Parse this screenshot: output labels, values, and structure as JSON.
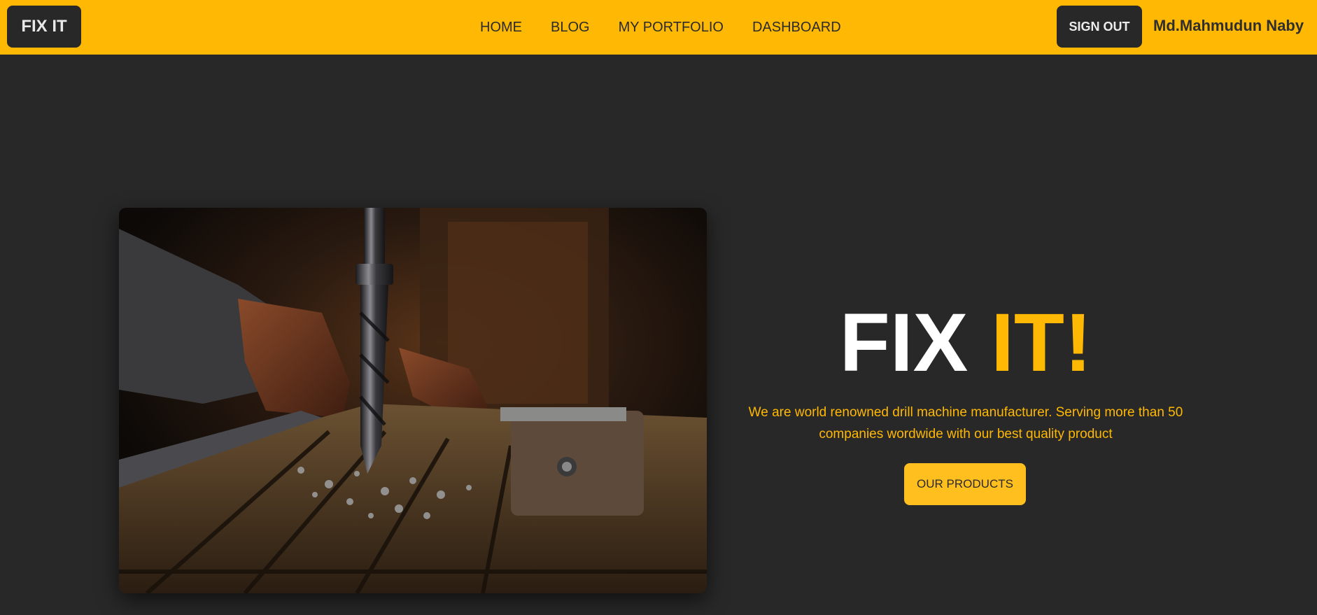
{
  "brand": {
    "label": "FIX IT"
  },
  "nav": {
    "items": [
      {
        "label": "HOME"
      },
      {
        "label": "BLOG"
      },
      {
        "label": "MY PORTFOLIO"
      },
      {
        "label": "DASHBOARD"
      }
    ]
  },
  "auth": {
    "signout_label": "SIGN OUT",
    "username": "Md.Mahmudun Naby"
  },
  "hero": {
    "image_alt": "drill press bit in workshop",
    "title_part1": "FIX ",
    "title_part2": "IT!",
    "description": "We are world renowned drill machine manufacturer. Serving more than 50 companies wordwide with our best quality product",
    "cta_label": "OUR PRODUCTS"
  },
  "colors": {
    "accent": "#ffb803",
    "background": "#282828",
    "button_dark": "#282828"
  }
}
